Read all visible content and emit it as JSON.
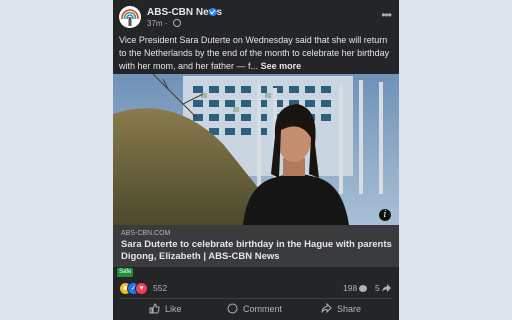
{
  "post": {
    "page_name": "ABS-CBN News",
    "time": "37m",
    "body": "Vice President Sara Duterte on Wednesday said that she will return to the Netherlands by the end of the month to celebrate her birthday with her mom, and her father — f...",
    "see_more": "See more"
  },
  "link_preview": {
    "domain": "ABS-CBN.COM",
    "title": "Sara Duterte to celebrate birthday in the Hague with parents Digong, Elizabeth | ABS-CBN News",
    "badge": "Safe"
  },
  "engagement": {
    "reactions": "552",
    "comments": "198",
    "shares": "5"
  },
  "actions": {
    "like": "Like",
    "comment": "Comment",
    "share": "Share"
  },
  "icons": [
    "abs-cbn-logo",
    "verified-badge-icon",
    "globe-icon",
    "more-options-icon",
    "info-icon",
    "haha-reaction-icon",
    "like-reaction-icon",
    "love-reaction-icon",
    "comment-bubble-icon",
    "share-arrow-icon",
    "thumbs-up-icon",
    "comment-icon",
    "share-icon"
  ],
  "colors": {
    "page_background": "#dfe3ee",
    "card_background": "#242526",
    "link_box_background": "#3a3b3c",
    "verified_blue": "#2d88ff",
    "safe_green": "#1e8e3e"
  }
}
